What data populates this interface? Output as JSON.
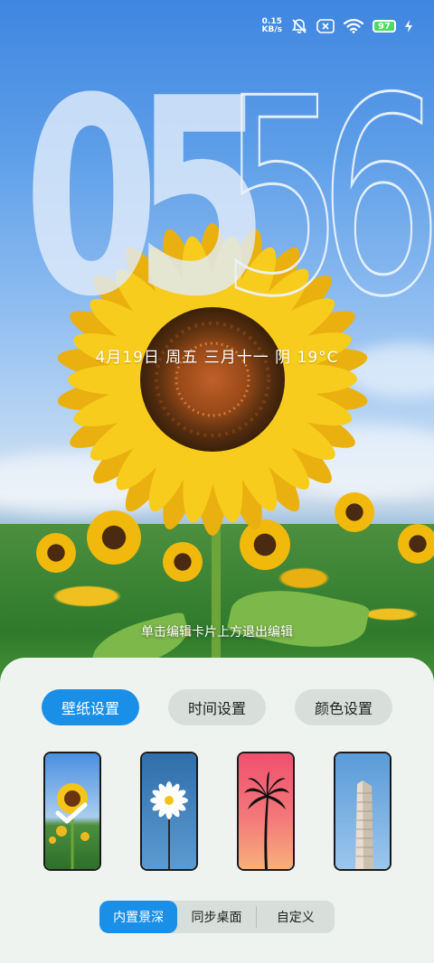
{
  "status_bar": {
    "net_speed_value": "0.15",
    "net_speed_unit": "KB/s",
    "battery": "97",
    "icons": [
      "mute-icon",
      "sim-off-icon",
      "wifi-icon",
      "battery-icon",
      "charging-icon"
    ]
  },
  "clock": {
    "hours": "05",
    "minutes": "56"
  },
  "date_line": "4月19日  周五  三月十一  阴 19°C",
  "hint": "单击编辑卡片上方退出编辑",
  "settings_tabs": [
    {
      "label": "壁纸设置",
      "active": true
    },
    {
      "label": "时间设置",
      "active": false
    },
    {
      "label": "颜色设置",
      "active": false
    }
  ],
  "wallpapers": [
    {
      "name": "sunflower",
      "selected": true
    },
    {
      "name": "daisy",
      "selected": false
    },
    {
      "name": "palm-tree",
      "selected": false
    },
    {
      "name": "flatiron-building",
      "selected": false
    }
  ],
  "segments": [
    {
      "label": "内置景深",
      "active": true
    },
    {
      "label": "同步桌面",
      "active": false
    },
    {
      "label": "自定义",
      "active": false
    }
  ],
  "colors": {
    "accent": "#1a8fe8",
    "panel": "#eef3f0",
    "inactive_tab": "#d8dfdb"
  }
}
